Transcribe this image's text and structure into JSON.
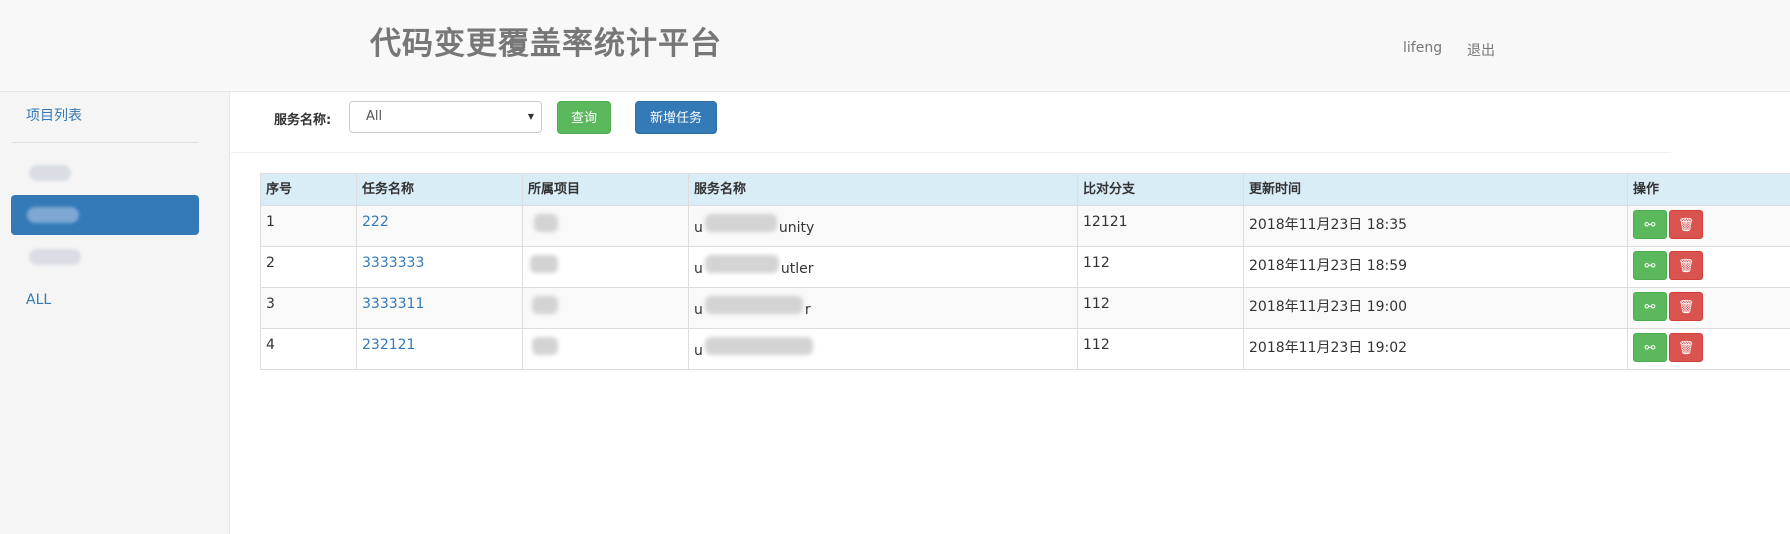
{
  "header": {
    "title": "代码变更覆盖率统计平台",
    "user": "lifeng",
    "logout": "退出"
  },
  "sidebar": {
    "header": "项目列表",
    "items": [
      {
        "label": "",
        "blurred": true
      },
      {
        "label": "",
        "blurred": true,
        "active": true
      },
      {
        "label": "",
        "blurred": true
      },
      {
        "label": "ALL"
      }
    ]
  },
  "toolbar": {
    "service_label": "服务名称:",
    "service_select": "All",
    "query_button": "查询",
    "new_task_button": "新增任务"
  },
  "table": {
    "columns": [
      "序号",
      "任务名称",
      "所属项目",
      "服务名称",
      "比对分支",
      "更新时间",
      "操作"
    ],
    "rows": [
      {
        "index": "1",
        "task": "222",
        "project": "",
        "service_prefix": "u",
        "service_suffix": "unity",
        "branch": "12121",
        "updated": "2018年11月23日 18:35"
      },
      {
        "index": "2",
        "task": "3333333",
        "project": "",
        "service_prefix": "u",
        "service_suffix": "utler",
        "branch": "112",
        "updated": "2018年11月23日 18:59"
      },
      {
        "index": "3",
        "task": "3333311",
        "project": "",
        "service_prefix": "u",
        "service_suffix": "r",
        "branch": "112",
        "updated": "2018年11月23日 19:00"
      },
      {
        "index": "4",
        "task": "232121",
        "project": "",
        "service_prefix": "u",
        "service_suffix": "",
        "branch": "112",
        "updated": "2018年11月23日 19:02"
      }
    ]
  },
  "icons": {
    "edit": "plug-icon",
    "delete": "trash-icon"
  },
  "colors": {
    "primary": "#337ab7",
    "success": "#5cb85c",
    "danger": "#d9534f",
    "table_header": "#d9edf7"
  }
}
